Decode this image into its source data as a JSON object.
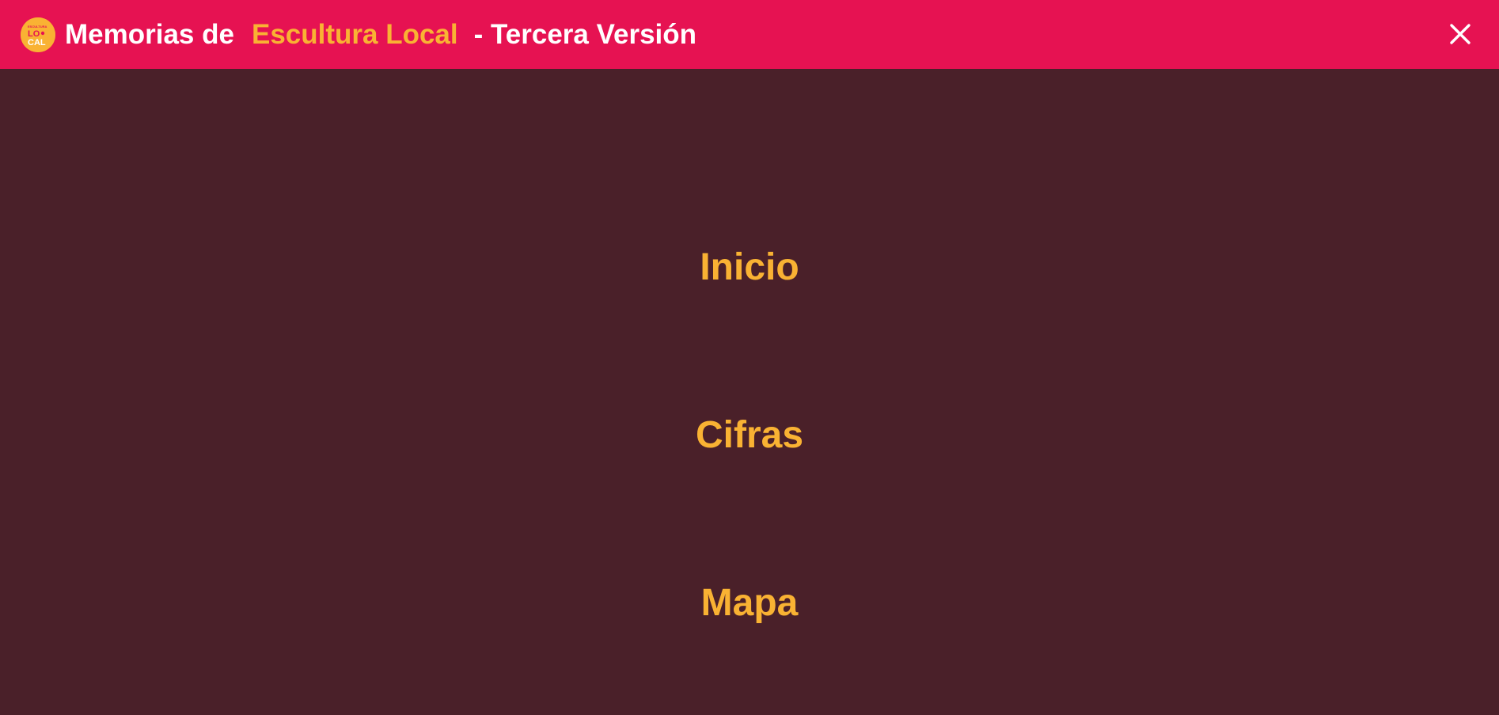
{
  "header": {
    "logo_text": "LO CAL",
    "title_prefix": "Memorias de",
    "title_accent": "Escultura Local",
    "title_suffix": "- Tercera Versión",
    "close_icon": "close-icon"
  },
  "menu": {
    "items": [
      {
        "label": "Inicio"
      },
      {
        "label": "Cifras"
      },
      {
        "label": "Mapa"
      }
    ]
  },
  "colors": {
    "header_bg": "#e61252",
    "page_bg": "#4a2029",
    "accent": "#f9b233",
    "title_text": "#ffffff"
  }
}
